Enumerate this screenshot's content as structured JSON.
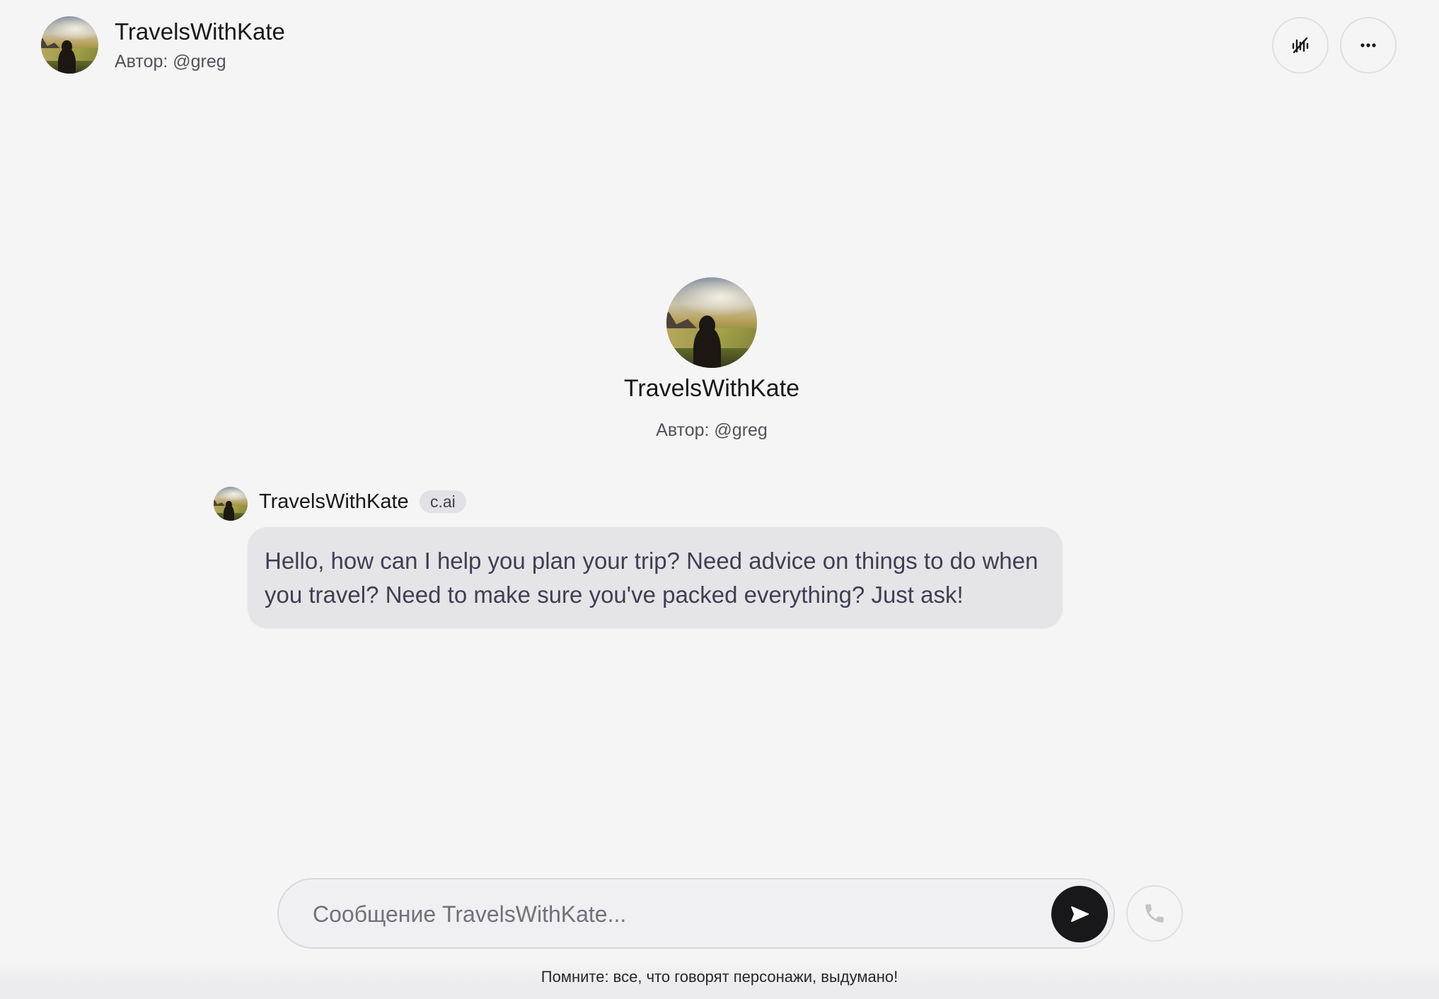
{
  "header": {
    "title": "TravelsWithKate",
    "author": "Автор: @greg",
    "voice_icon": "voice-off-icon",
    "more_icon": "more-horizontal-icon"
  },
  "intro": {
    "name": "TravelsWithKate",
    "author": "Автор: @greg"
  },
  "messages": [
    {
      "sender": "TravelsWithKate",
      "badge": "c.ai",
      "text": "Hello, how can I help you plan your trip? Need advice on things to do when you travel? Need to make sure you've packed everything? Just ask!"
    }
  ],
  "composer": {
    "placeholder": "Сообщение TravelsWithKate...",
    "send_icon": "send-icon",
    "call_icon": "phone-icon"
  },
  "footer": {
    "disclaimer": "Помните: все, что говорят персонажи, выдумано!"
  },
  "colors": {
    "background": "#f5f5f5",
    "bubble": "#e5e5e8",
    "send_button": "#18181b"
  }
}
